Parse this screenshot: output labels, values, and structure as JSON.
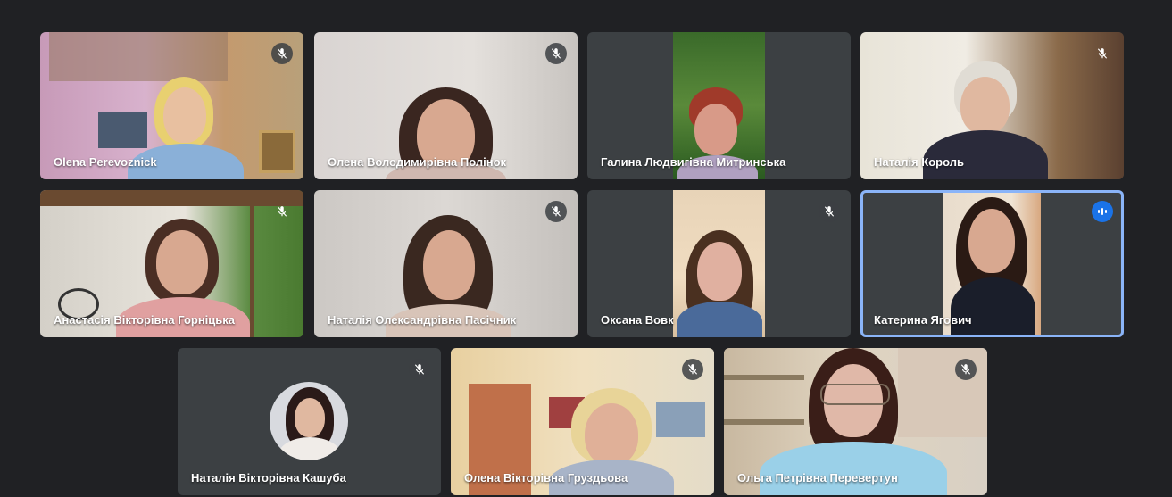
{
  "participants": [
    {
      "name": "Olena Perevoznick",
      "mic": "muted-mic-icon"
    },
    {
      "name": "Олена Володимирівна Полінок",
      "mic": "muted-mic-icon"
    },
    {
      "name": "Галина Людвигівна Митринська",
      "mic": "muted-mic-icon"
    },
    {
      "name": "Наталія Король",
      "mic": "muted-mic-icon"
    },
    {
      "name": "Анастасія Вікторівна Горніцька",
      "mic": "muted-mic-icon"
    },
    {
      "name": "Наталія Олександрівна Пасічник",
      "mic": "muted-mic-icon"
    },
    {
      "name": "Оксана Вовк",
      "mic": "muted-mic-icon"
    },
    {
      "name": "Катерина Ягович",
      "mic": "speaking-indicator-icon",
      "speaking": true
    },
    {
      "name": "Наталія Вікторівна Кашуба",
      "mic": "muted-mic-icon"
    },
    {
      "name": "Олена Вікторівна Груздьова",
      "mic": "muted-mic-icon"
    },
    {
      "name": "Ольга Петрівна Перевертун",
      "mic": "muted-mic-icon"
    }
  ],
  "colors": {
    "background": "#202124",
    "tile": "#3c4043",
    "active_border": "#8ab4f8",
    "speaking_badge": "#1a73e8"
  }
}
